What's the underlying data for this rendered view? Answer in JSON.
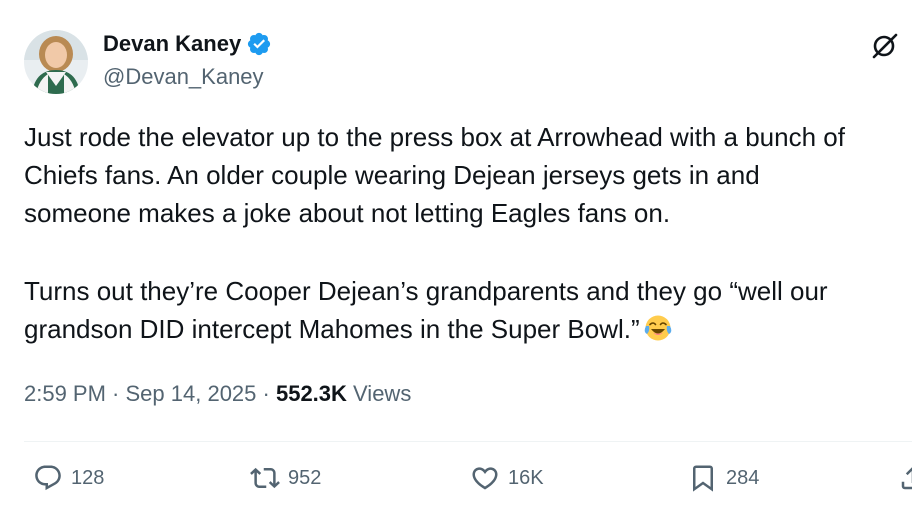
{
  "author": {
    "display_name": "Devan Kaney",
    "handle": "@Devan_Kaney",
    "verified": true,
    "verified_color": "#1d9bf0"
  },
  "tweet": {
    "lines_para1": [
      "Just rode the elevator up to the press box at Arrowhead with a bunch of",
      "Chiefs fans. An older couple wearing Dejean jerseys gets in and",
      "someone makes a joke about not letting Eagles fans on."
    ],
    "lines_para2": [
      "Turns out they’re Cooper Dejean’s grandparents and they go “well our",
      "grandson DID intercept Mahomes in the Super Bowl.”"
    ],
    "emoji": "face-with-tears-of-joy"
  },
  "meta": {
    "time": "2:59 PM",
    "sep1": " · ",
    "date": "Sep 14, 2025",
    "sep2": " · ",
    "views_count": "552.3K",
    "views_label": " Views"
  },
  "actions": {
    "replies": "128",
    "retweets": "952",
    "likes": "16K",
    "bookmarks": "284"
  },
  "icons": {
    "grok": "grok-icon",
    "reply": "reply-icon",
    "retweet": "retweet-icon",
    "like": "heart-icon",
    "bookmark": "bookmark-icon",
    "share": "share-icon"
  }
}
